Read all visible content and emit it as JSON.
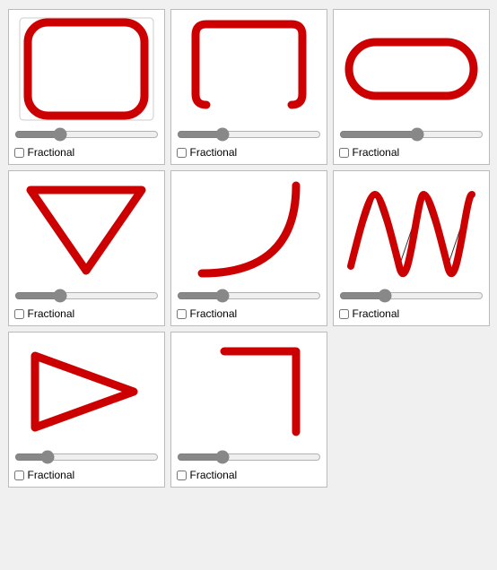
{
  "cards": [
    {
      "id": "card-1",
      "label": "Fractional",
      "sliderValue": 30,
      "sliderMin": 0,
      "sliderMax": 100,
      "checked": false,
      "shape": "rounded-square-full"
    },
    {
      "id": "card-2",
      "label": "Fractional",
      "sliderValue": 30,
      "sliderMin": 0,
      "sliderMax": 100,
      "checked": false,
      "shape": "rounded-square-partial"
    },
    {
      "id": "card-3",
      "label": "Fractional",
      "sliderValue": 55,
      "sliderMin": 0,
      "sliderMax": 100,
      "checked": false,
      "shape": "rounded-rect-wide"
    },
    {
      "id": "card-4",
      "label": "Fractional",
      "sliderValue": 30,
      "sliderMin": 0,
      "sliderMax": 100,
      "checked": false,
      "shape": "triangle"
    },
    {
      "id": "card-5",
      "label": "Fractional",
      "sliderValue": 30,
      "sliderMin": 0,
      "sliderMax": 100,
      "checked": false,
      "shape": "curve"
    },
    {
      "id": "card-6",
      "label": "Fractional",
      "sliderValue": 30,
      "sliderMin": 0,
      "sliderMax": 100,
      "checked": false,
      "shape": "wave"
    },
    {
      "id": "card-7",
      "label": "Fractional",
      "sliderValue": 20,
      "sliderMin": 0,
      "sliderMax": 100,
      "checked": false,
      "shape": "arrow"
    },
    {
      "id": "card-8",
      "label": "Fractional",
      "sliderValue": 30,
      "sliderMin": 0,
      "sliderMax": 100,
      "checked": false,
      "shape": "corner"
    }
  ]
}
